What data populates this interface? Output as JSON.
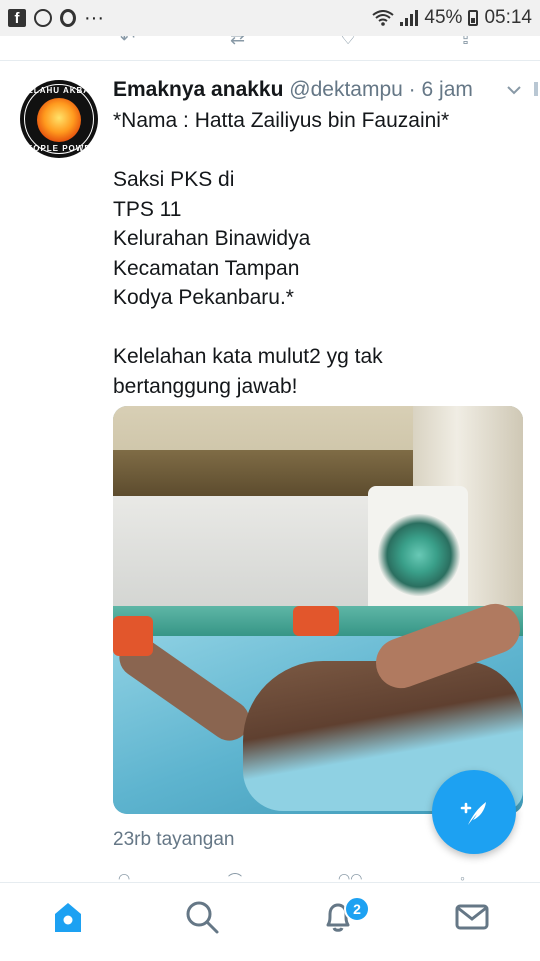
{
  "status_bar": {
    "left_icons": [
      "facebook-icon",
      "whatsapp-icon",
      "opera-icon"
    ],
    "more": "···",
    "battery_percent": "45%",
    "time": "05:14"
  },
  "tweet": {
    "display_name": "Emaknya anakku",
    "handle": "@dektampu",
    "separator": "·",
    "time": "6 jam",
    "body_lines": [
      "*Nama : Hatta Zailiyus bin Fauzaini*",
      "",
      "Saksi PKS di",
      "TPS 11",
      "Kelurahan Binawidya",
      "Kecamatan Tampan",
      "Kodya Pekanbaru.*",
      "",
      "Kelelahan kata mulut2 yg tak",
      "bertanggung jawab!"
    ],
    "views": "23rb tayangan",
    "avatar_text_top": "ALLAHU AKBAR",
    "avatar_text_bottom": "PEOPLE POWER"
  },
  "nav": {
    "tabs": [
      "home-icon",
      "search-icon",
      "notifications-icon",
      "messages-icon"
    ],
    "notification_count": "2"
  },
  "colors": {
    "accent": "#1da1f2",
    "secondary_text": "#657786",
    "primary_text": "#14171a"
  }
}
